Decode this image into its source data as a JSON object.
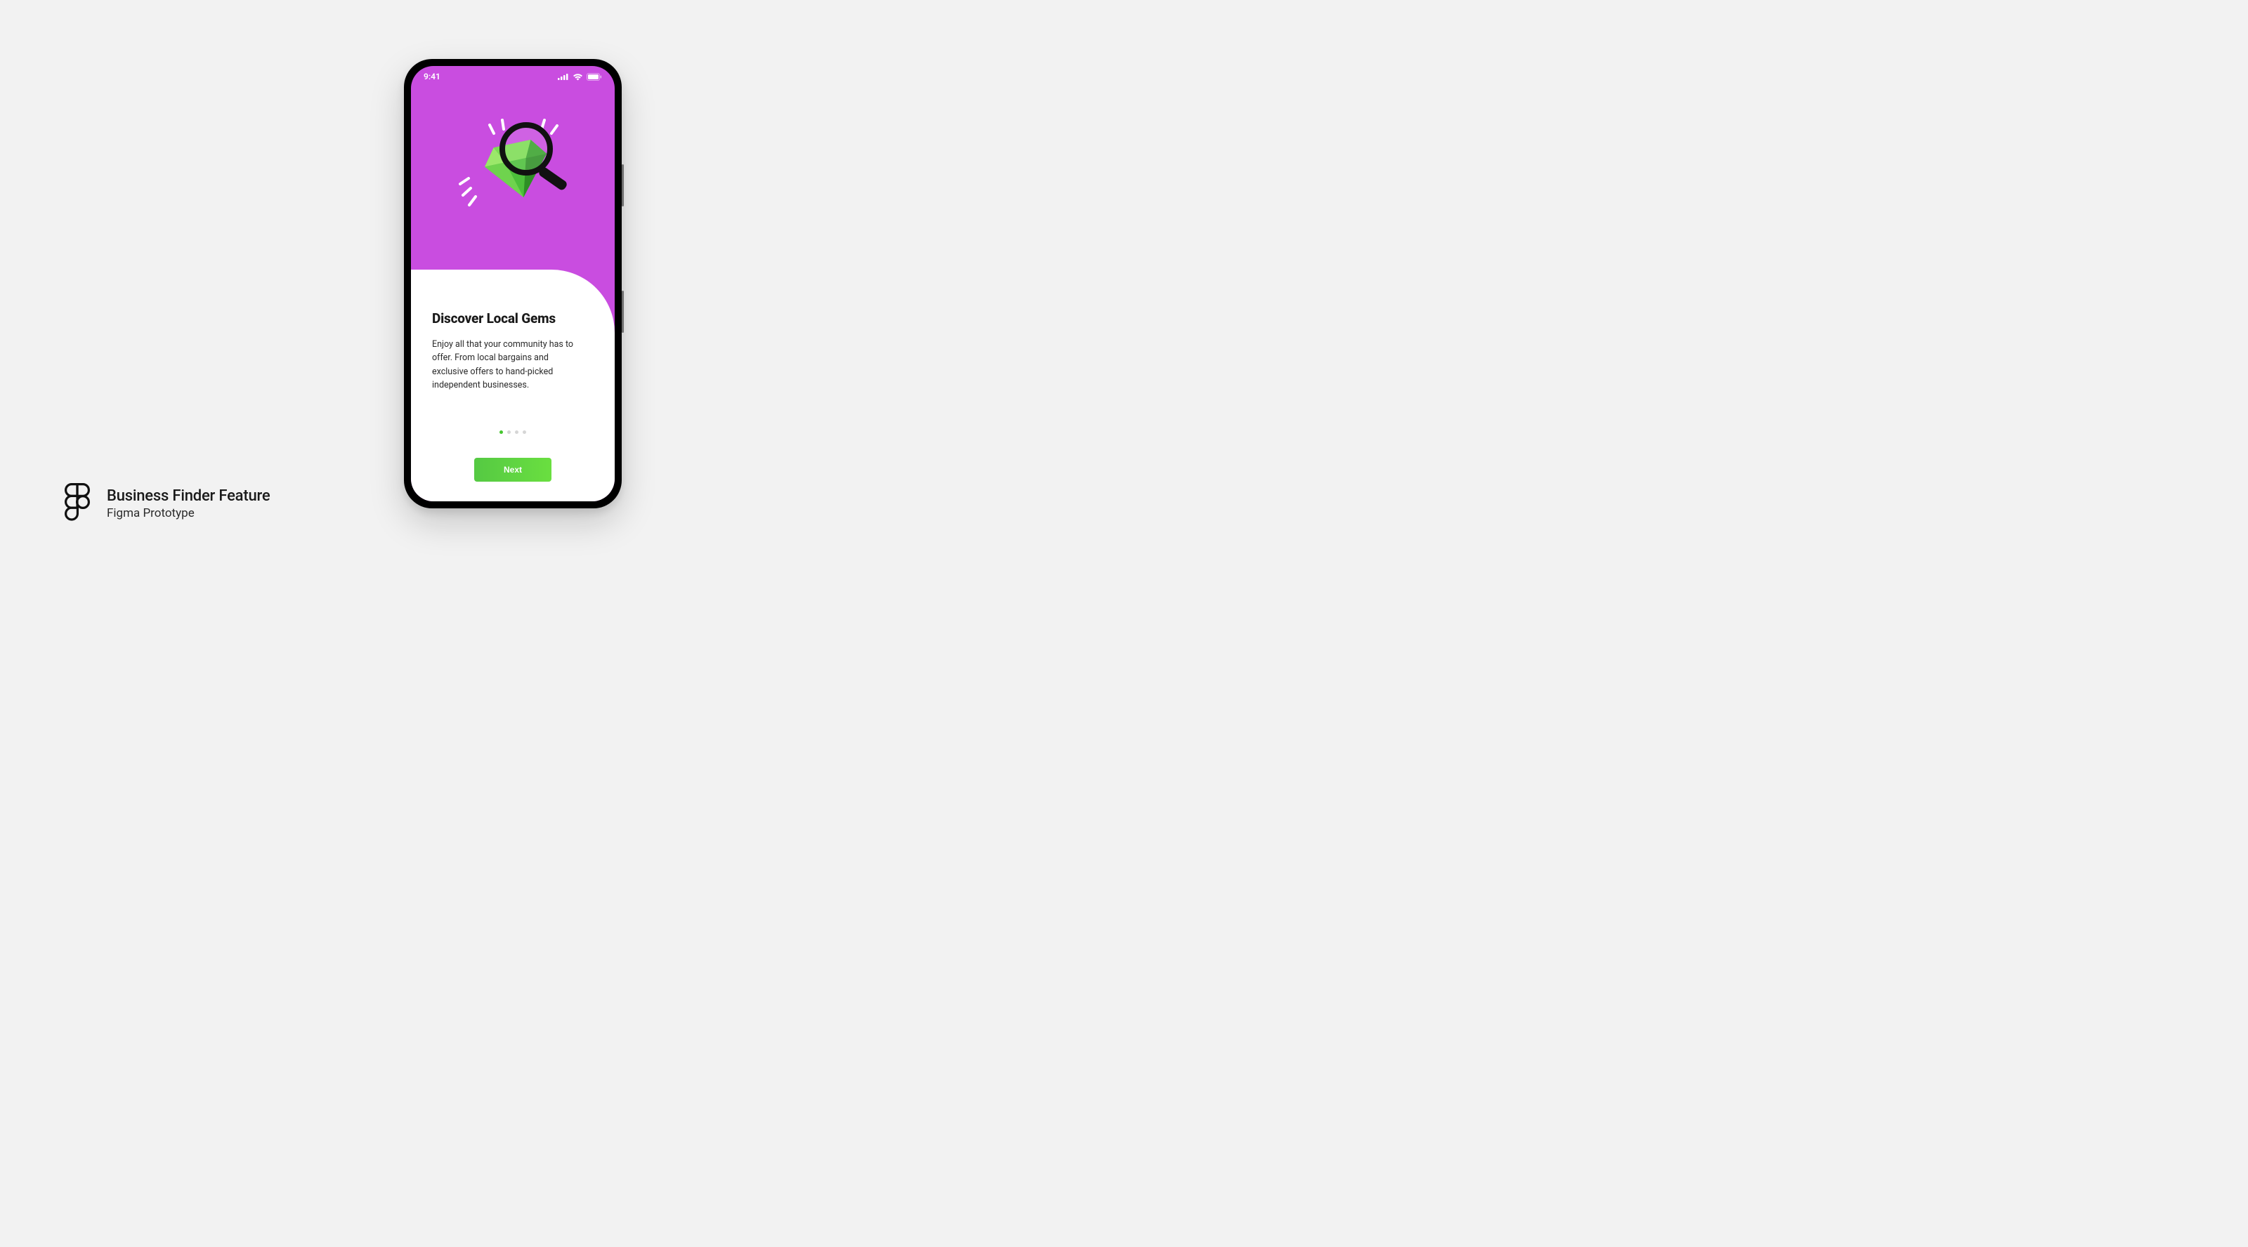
{
  "status": {
    "time": "9:41"
  },
  "onboarding": {
    "heading": "Discover Local Gems",
    "body": "Enjoy all that your community has to offer. From local bargains and exclusive offers to hand-picked independent businesses.",
    "cta": "Next",
    "page_count": 4,
    "active_page": 0
  },
  "caption": {
    "title": "Business Finder Feature",
    "subtitle": "Figma Prototype"
  },
  "colors": {
    "hero_bg": "#c94de0",
    "accent": "#46c62f"
  }
}
